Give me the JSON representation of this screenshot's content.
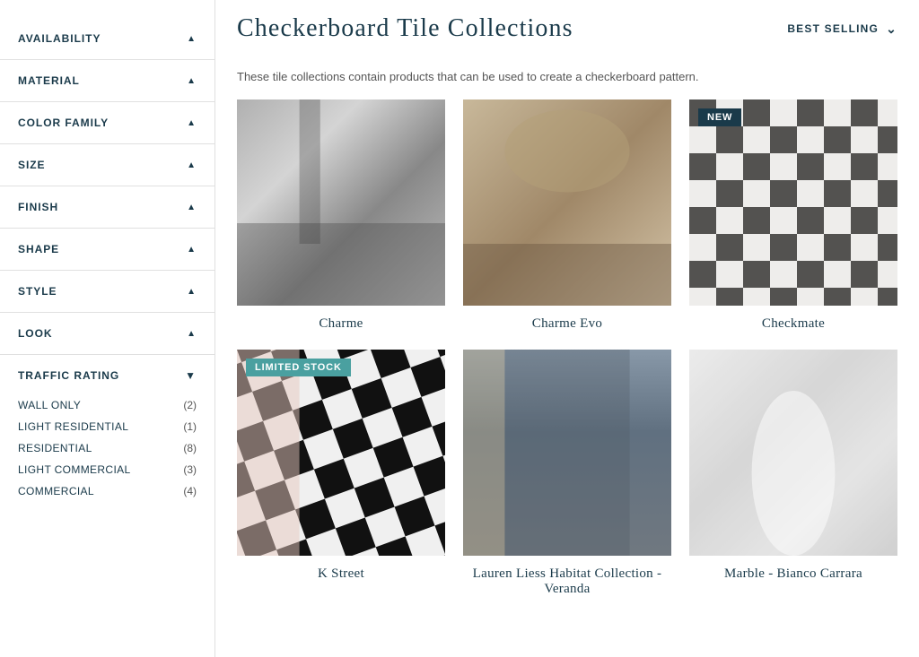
{
  "site": {
    "title": "Checkerboard Tile Collections"
  },
  "sort": {
    "label": "BEST SELLING",
    "chevron": "⌄"
  },
  "description": "These tile collections contain products that can be used to create a checkerboard pattern.",
  "sidebar": {
    "filters": [
      {
        "id": "availability",
        "label": "AVAILABILITY",
        "expanded": true
      },
      {
        "id": "material",
        "label": "MATERIAL",
        "expanded": true
      },
      {
        "id": "color-family",
        "label": "COLOR FAMILY",
        "expanded": true
      },
      {
        "id": "size",
        "label": "SIZE",
        "expanded": true
      },
      {
        "id": "finish",
        "label": "FINISH",
        "expanded": true
      },
      {
        "id": "shape",
        "label": "SHAPE",
        "expanded": true
      },
      {
        "id": "style",
        "label": "STYLE",
        "expanded": true
      },
      {
        "id": "look",
        "label": "LOOK",
        "expanded": true
      }
    ],
    "traffic_rating": {
      "label": "TRAFFIC RATING",
      "items": [
        {
          "label": "WALL ONLY",
          "count": "(2)"
        },
        {
          "label": "LIGHT RESIDENTIAL",
          "count": "(1)"
        },
        {
          "label": "RESIDENTIAL",
          "count": "(8)"
        },
        {
          "label": "LIGHT COMMERCIAL",
          "count": "(3)"
        },
        {
          "label": "COMMERCIAL",
          "count": "(4)"
        }
      ]
    }
  },
  "products": [
    {
      "id": "charme",
      "name": "Charme",
      "badge": null,
      "badge_text": "",
      "image_class": "img-charme"
    },
    {
      "id": "charme-evo",
      "name": "Charme Evo",
      "badge": null,
      "badge_text": "",
      "image_class": "img-charme-evo"
    },
    {
      "id": "checkmate",
      "name": "Checkmate",
      "badge": "new",
      "badge_text": "NEW",
      "image_class": "img-checkmate"
    },
    {
      "id": "kstreet",
      "name": "K Street",
      "badge": "limited",
      "badge_text": "LIMITED STOCK",
      "image_class": "img-kstreet"
    },
    {
      "id": "lauren",
      "name": "Lauren Liess Habitat Collection - Veranda",
      "badge": null,
      "badge_text": "",
      "image_class": "img-lauren"
    },
    {
      "id": "marble",
      "name": "Marble - Bianco Carrara",
      "badge": null,
      "badge_text": "",
      "image_class": "img-marble"
    }
  ]
}
